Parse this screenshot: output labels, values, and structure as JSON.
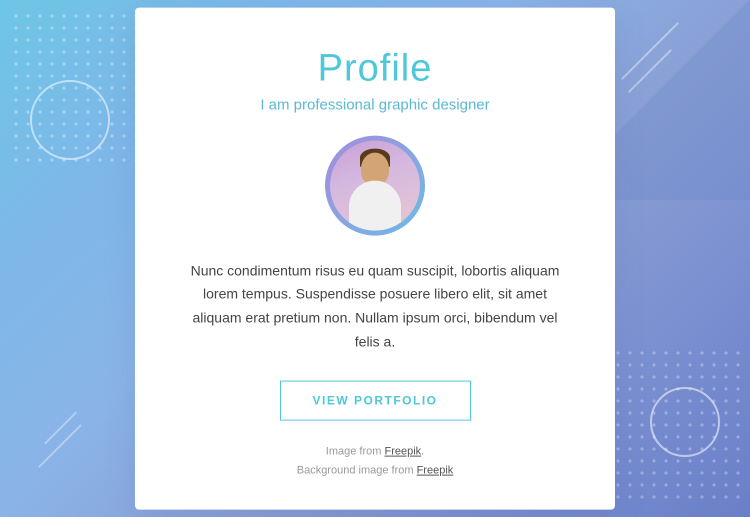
{
  "background": {
    "gradient_start": "#6ec6e6",
    "gradient_end": "#6a7fc8"
  },
  "card": {
    "title": "Profile",
    "subtitle": "I am professional graphic designer",
    "description": "Nunc condimentum risus eu quam suscipit, lobortis aliquam lorem tempus. Suspendisse posuere libero elit, sit amet aliquam erat pretium non. Nullam ipsum orci, bibendum vel felis a.",
    "button_label": "VIEW PORTFOLIO",
    "footer_line1": "Image from Freepik.",
    "footer_line2": "Background image from Freepik",
    "footer_link1": "Freepik",
    "footer_link2": "Freepik"
  }
}
